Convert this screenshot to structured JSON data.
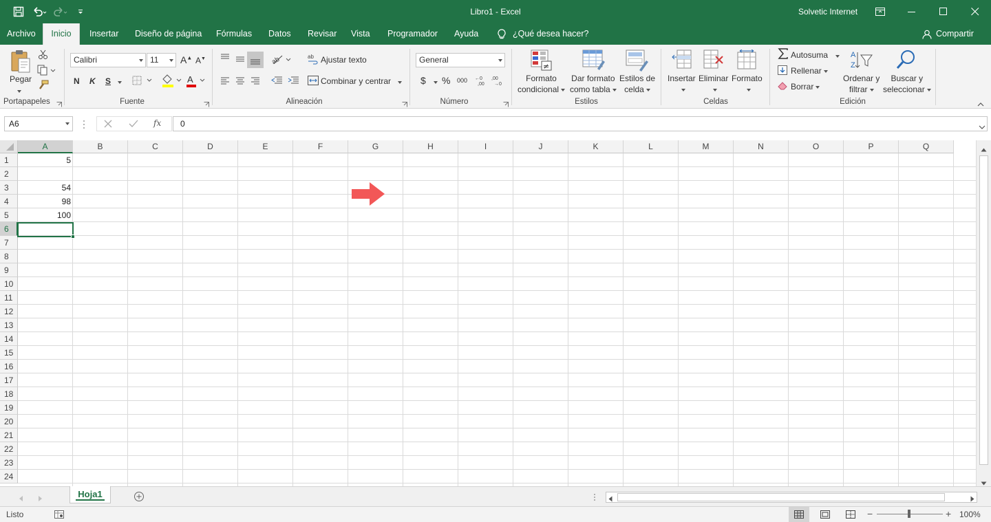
{
  "window": {
    "title": "Libro1  -  Excel",
    "user": "Solvetic Internet"
  },
  "colors": {
    "brand": "#217346",
    "annotation_arrow": "#f25757"
  },
  "quick_access": {
    "icons": [
      "save-icon",
      "undo-icon",
      "redo-icon",
      "customize-icon"
    ]
  },
  "tabs": [
    {
      "label": "Archivo"
    },
    {
      "label": "Inicio",
      "active": true
    },
    {
      "label": "Insertar"
    },
    {
      "label": "Diseño de página"
    },
    {
      "label": "Fórmulas"
    },
    {
      "label": "Datos"
    },
    {
      "label": "Revisar"
    },
    {
      "label": "Vista"
    },
    {
      "label": "Programador"
    },
    {
      "label": "Ayuda"
    }
  ],
  "tell_me": "¿Qué desea hacer?",
  "share": "Compartir",
  "ribbon": {
    "clipboard": {
      "group": "Portapapeles",
      "paste": "Pegar"
    },
    "font": {
      "group": "Fuente",
      "family": "Calibri",
      "size": "11",
      "bold": "N",
      "italic": "K",
      "underline": "S"
    },
    "alignment": {
      "group": "Alineación",
      "wrap": "Ajustar texto",
      "merge": "Combinar y centrar"
    },
    "number": {
      "group": "Número",
      "format": "General"
    },
    "styles": {
      "group": "Estilos",
      "cond_format_1": "Formato",
      "cond_format_2": "condicional",
      "table_format_1": "Dar formato",
      "table_format_2": "como tabla",
      "cell_styles_1": "Estilos de",
      "cell_styles_2": "celda"
    },
    "cells": {
      "group": "Celdas",
      "insert": "Insertar",
      "delete": "Eliminar",
      "format": "Formato"
    },
    "editing": {
      "group": "Edición",
      "autosum": "Autosuma",
      "fill": "Rellenar",
      "clear": "Borrar",
      "sort_1": "Ordenar y",
      "sort_2": "filtrar",
      "find_1": "Buscar y",
      "find_2": "seleccionar"
    }
  },
  "formula_bar": {
    "name_box": "A6",
    "formula": "0"
  },
  "sheet": {
    "columns": [
      "A",
      "B",
      "C",
      "D",
      "E",
      "F",
      "G",
      "H",
      "I",
      "J",
      "K",
      "L",
      "M",
      "N",
      "O",
      "P",
      "Q"
    ],
    "rows": [
      "1",
      "2",
      "3",
      "4",
      "5",
      "6",
      "7",
      "8",
      "9",
      "10",
      "11",
      "12",
      "13",
      "14",
      "15",
      "16",
      "17",
      "18",
      "19",
      "20",
      "21",
      "22",
      "23",
      "24"
    ],
    "cells": [
      {
        "ref": "A1",
        "value": "5"
      },
      {
        "ref": "A3",
        "value": "54"
      },
      {
        "ref": "A4",
        "value": "98"
      },
      {
        "ref": "A5",
        "value": "100"
      }
    ],
    "active_cell": "A6"
  },
  "sheet_tabs": [
    {
      "label": "Hoja1",
      "active": true
    }
  ],
  "status": {
    "mode": "Listo",
    "zoom": "100%"
  }
}
